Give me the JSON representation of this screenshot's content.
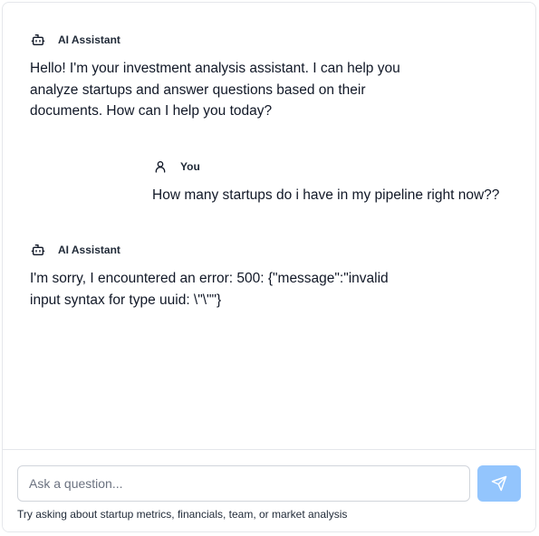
{
  "messages": [
    {
      "role": "assistant",
      "author": "AI Assistant",
      "icon": "bot-icon",
      "text": "Hello! I'm your investment analysis assistant. I can help you analyze startups and answer questions based on their documents. How can I help you today?"
    },
    {
      "role": "user",
      "author": "You",
      "icon": "user-icon",
      "text": "How many startups do i have in my pipeline right now??"
    },
    {
      "role": "assistant",
      "author": "AI Assistant",
      "icon": "bot-icon",
      "text": "I'm sorry, I encountered an error: 500: {\"message\":\"invalid input syntax for type uuid: \\\"\\\"\"}"
    }
  ],
  "composer": {
    "placeholder": "Ask a question...",
    "value": "",
    "send_icon": "send-icon",
    "hint": "Try asking about startup metrics, financials, team, or market analysis"
  },
  "colors": {
    "send_button_bg": "#93c5fd",
    "border": "#e5e7eb",
    "text": "#111827"
  }
}
